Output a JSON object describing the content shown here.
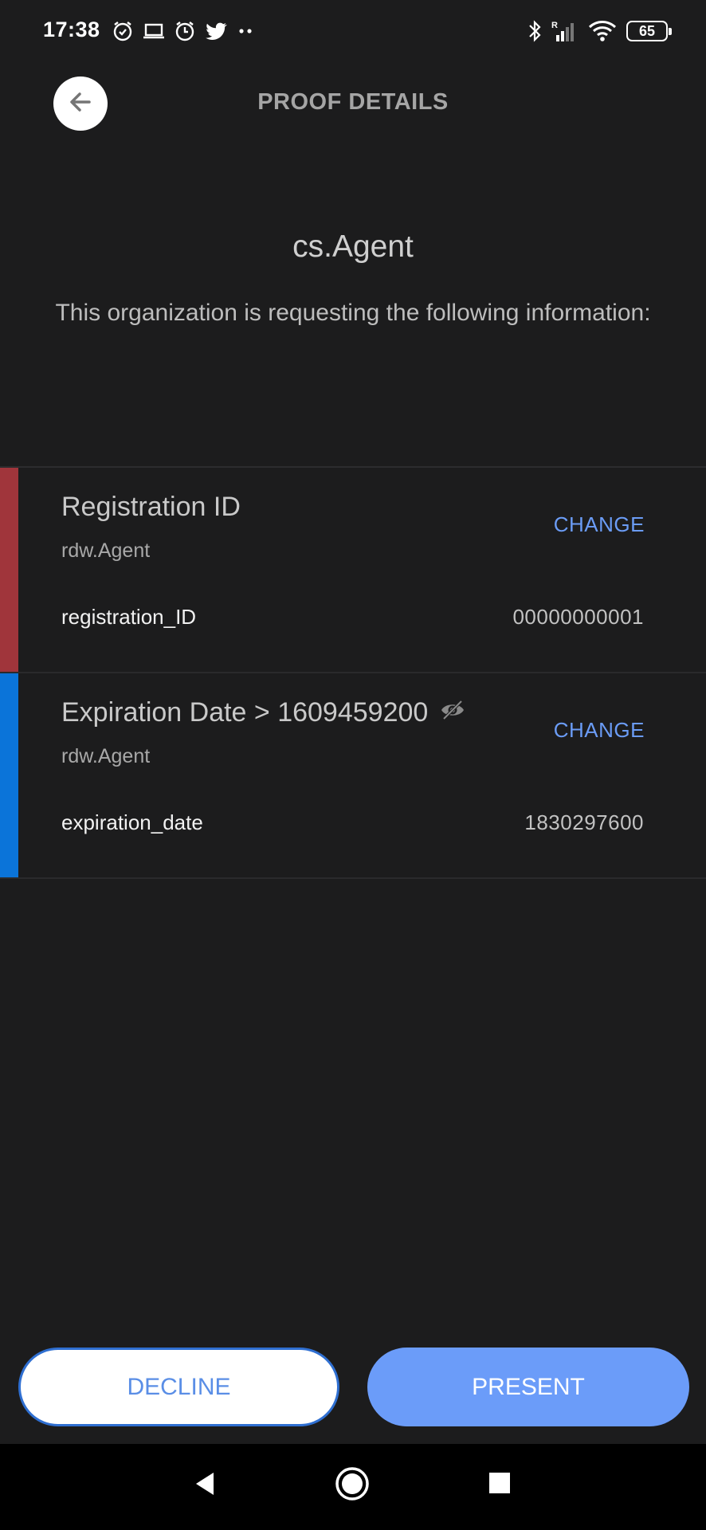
{
  "status_bar": {
    "time": "17:38",
    "left_icons": [
      "alarm-icon",
      "laptop-icon",
      "alarm-icon",
      "twitter-icon",
      "more-dots-icon"
    ],
    "right_icons": [
      "bluetooth-icon",
      "cellular-signal-icon",
      "wifi-icon"
    ],
    "signal_label": "R",
    "battery_level": "65"
  },
  "header": {
    "back_icon": "arrow-left-icon",
    "title": "PROOF DETAILS"
  },
  "organization": {
    "name": "cs.Agent",
    "request_text": "This organization is requesting the following information:"
  },
  "attributes": [
    {
      "title": "Registration ID",
      "issuer": "rdw.Agent",
      "change_label": "CHANGE",
      "field_name": "registration_ID",
      "field_value": "00000000001",
      "stripe_color": "#a0353b",
      "predicate_icon": null
    },
    {
      "title": "Expiration Date > 1609459200",
      "issuer": "rdw.Agent",
      "change_label": "CHANGE",
      "field_name": "expiration_date",
      "field_value": "1830297600",
      "stripe_color": "#0b74d9",
      "predicate_icon": "eye-hidden-icon"
    }
  ],
  "actions": {
    "decline_label": "DECLINE",
    "present_label": "PRESENT"
  },
  "nav_bar": {
    "buttons": [
      "back-triangle-icon",
      "home-circle-icon",
      "recents-square-icon"
    ]
  }
}
